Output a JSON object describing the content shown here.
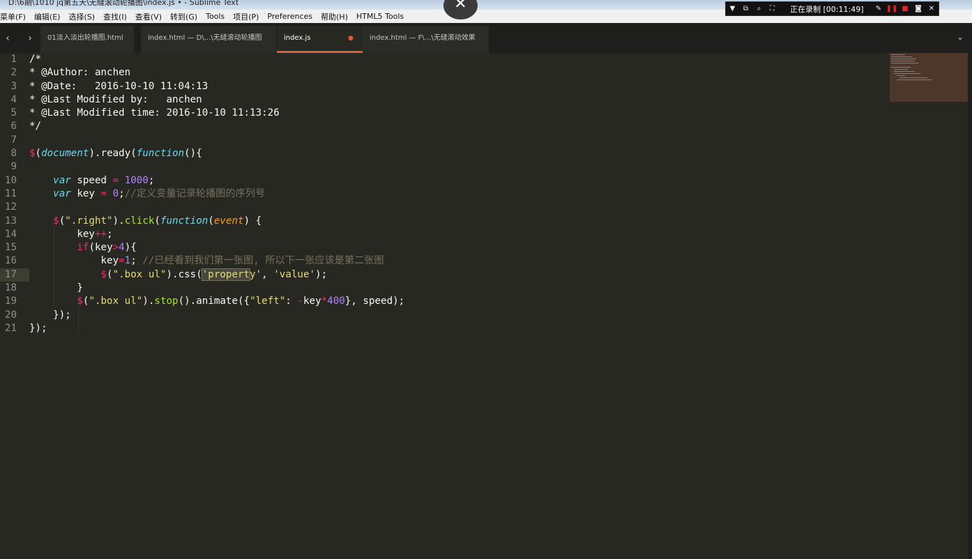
{
  "window": {
    "title": "D:\\6期\\1010 jq第五天\\无缝滚动轮播图\\index.js • - Sublime Text"
  },
  "overlay": {
    "close_glyph": "✕"
  },
  "menu": {
    "items": [
      "菜单(F)",
      "编辑(E)",
      "选择(S)",
      "查找(I)",
      "查看(V)",
      "转到(G)",
      "Tools",
      "项目(P)",
      "Preferences",
      "帮助(H)",
      "HTML5 Tools"
    ]
  },
  "recorder": {
    "status": "正在录制 [00:11:49]"
  },
  "tabs": [
    {
      "label": "01淡入淡出轮播图.html",
      "active": false
    },
    {
      "label": "index.html — D\\...\\无缝滚动轮播图",
      "active": false
    },
    {
      "label": "index.js",
      "active": true,
      "dirty": true
    },
    {
      "label": "index.html — F\\...\\无缝滚动效果",
      "active": false
    }
  ],
  "tab_nav": {
    "prev": "‹",
    "next": "›",
    "dropdown": "⌄",
    "dirty_marker": "●"
  },
  "editor": {
    "line_numbers": [
      "1",
      "2",
      "3",
      "4",
      "5",
      "6",
      "7",
      "8",
      "9",
      "10",
      "11",
      "12",
      "13",
      "14",
      "15",
      "16",
      "17",
      "18",
      "19",
      "20",
      "21"
    ],
    "current_line": 17,
    "comment_header": [
      "/*",
      "* @Author: anchen",
      "* @Date:   2016-10-10 11:04:13",
      "* @Last Modified by:   anchen",
      "* @Last Modified time: 2016-10-10 11:13:26",
      "*/"
    ],
    "code": {
      "l8_doc": "document",
      "l8_ready": "ready",
      "l8_fn": "function",
      "l10_var": "var",
      "l10_name": "speed",
      "l10_val": "1000",
      "l11_var": "var",
      "l11_name": "key",
      "l11_val": "0",
      "l11_comment": "//定义变量记录轮播图的序列号",
      "l13_sel": "\".right\"",
      "l13_click": "click",
      "l13_fn": "function",
      "l13_event": "event",
      "l14_key": "key",
      "l15_if": "if",
      "l15_cond_key": "key",
      "l15_cond_val": "4",
      "l16_key": "key",
      "l16_val": "1",
      "l16_comment": "//已经看到我们第一张图, 所以下一张应该是第二张图",
      "l17_sel": "\".box ul\"",
      "l17_css": "css",
      "l17_prop_a": "'propert",
      "l17_prop_b": "y'",
      "l17_val": "'value'",
      "l19_sel": "\".box ul\"",
      "l19_stop": "stop",
      "l19_animate": "animate",
      "l19_left": "\"left\"",
      "l19_key": "key",
      "l19_num": "400",
      "l19_speed": "speed"
    }
  }
}
